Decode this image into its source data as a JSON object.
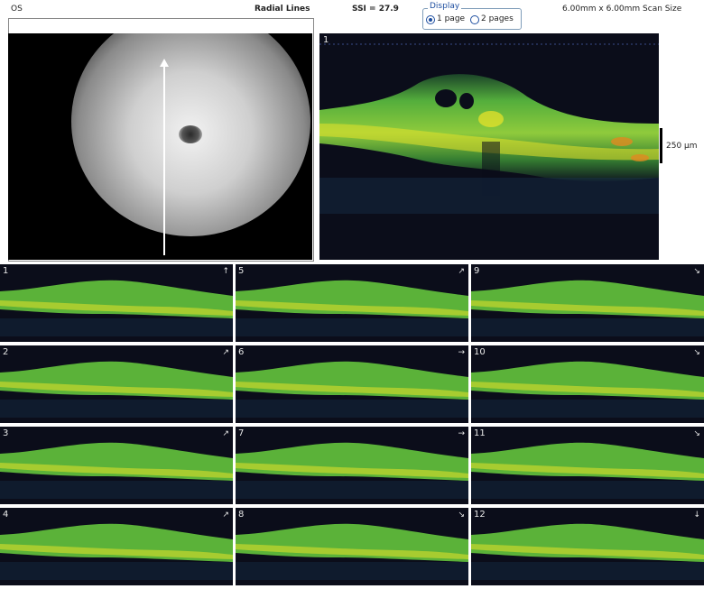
{
  "header": {
    "eye": "OS",
    "scan_pattern": "Radial Lines",
    "ssi": "SSI = 27.9",
    "display_legend": "Display",
    "display_options": [
      "1 page",
      "2 pages"
    ],
    "display_selected": "1 page",
    "scan_size": "6.00mm x 6.00mm Scan Size"
  },
  "main_scan": {
    "number": "1",
    "scale_label": "250 µm"
  },
  "thumbnails": [
    {
      "number": "1",
      "arrow": "↑"
    },
    {
      "number": "2",
      "arrow": "↗"
    },
    {
      "number": "3",
      "arrow": "↗"
    },
    {
      "number": "4",
      "arrow": "↗"
    },
    {
      "number": "5",
      "arrow": "↗"
    },
    {
      "number": "6",
      "arrow": "→"
    },
    {
      "number": "7",
      "arrow": "→"
    },
    {
      "number": "8",
      "arrow": "↘"
    },
    {
      "number": "9",
      "arrow": "↘"
    },
    {
      "number": "10",
      "arrow": "↘"
    },
    {
      "number": "11",
      "arrow": "↘"
    },
    {
      "number": "12",
      "arrow": "↓"
    }
  ],
  "colors": {
    "scan_bg": "#0b0d1a",
    "retina_green": "#7ee040",
    "retina_yellow": "#e6e22a",
    "retina_orange": "#e08a20"
  }
}
